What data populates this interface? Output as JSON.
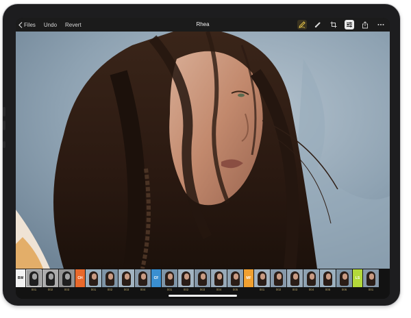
{
  "toolbar": {
    "back_label": "Files",
    "undo_label": "Undo",
    "revert_label": "Revert",
    "title": "Rhea",
    "icons": [
      "pen-icon",
      "brush-icon",
      "crop-icon",
      "sliders-icon",
      "share-icon",
      "more-icon"
    ]
  },
  "colors": {
    "accent_yellow": "#e7c64a",
    "bw": "#f2f2f2",
    "ch": "#e8692c",
    "cf": "#3a8fd1",
    "mf": "#f0a030",
    "ls": "#b3d93a"
  },
  "filmstrip": {
    "groups": [
      {
        "tag": "BW",
        "color": "#f2f2f2",
        "text_color": "#111111",
        "items": [
          "001",
          "002",
          "003"
        ]
      },
      {
        "tag": "CH",
        "color": "#e8692c",
        "text_color": "#ffffff",
        "items": [
          "001",
          "002",
          "003",
          "004"
        ]
      },
      {
        "tag": "CF",
        "color": "#3a8fd1",
        "text_color": "#ffffff",
        "items": [
          "001",
          "002",
          "003",
          "004",
          "005"
        ]
      },
      {
        "tag": "MF",
        "color": "#f0a030",
        "text_color": "#ffffff",
        "items": [
          "001",
          "002",
          "003",
          "004",
          "005",
          "006"
        ]
      },
      {
        "tag": "LS",
        "color": "#b3d93a",
        "text_color": "#ffffff",
        "items": [
          "001"
        ]
      }
    ]
  }
}
